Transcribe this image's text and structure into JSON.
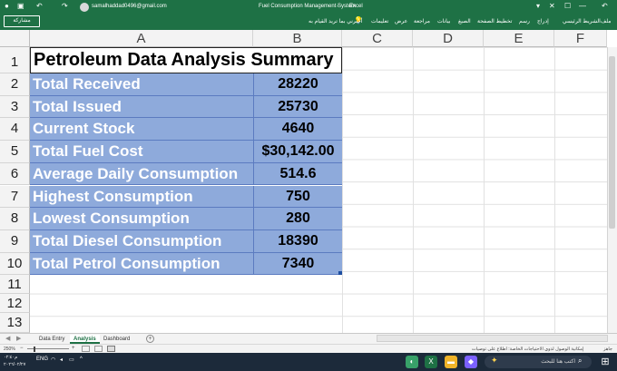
{
  "window": {
    "account_email": "samalhaddad0496@gmail.com",
    "title": "Fuel Consumption Management System",
    "separator": "-",
    "app_name": "Excel"
  },
  "ribbon": {
    "share_label": "مشاركة",
    "tabs": [
      "ملف",
      "الشريط الرئيسي",
      "إدراج",
      "رسم",
      "تخطيط الصفحة",
      "الصيغ",
      "بيانات",
      "مراجعة",
      "عرض",
      "تعليمات"
    ],
    "tell_me": "أخبرني بما تريد القيام به"
  },
  "columns": [
    "A",
    "B",
    "C",
    "D",
    "E",
    "F"
  ],
  "rows": [
    "1",
    "2",
    "3",
    "4",
    "5",
    "6",
    "7",
    "8",
    "9",
    "10",
    "11",
    "12",
    "13"
  ],
  "sheet": {
    "title": "Petroleum Data Analysis Summary",
    "items": [
      {
        "label": "Total Received",
        "value": "28220"
      },
      {
        "label": "Total Issued",
        "value": "25730"
      },
      {
        "label": "Current Stock",
        "value": "4640"
      },
      {
        "label": "Total Fuel Cost",
        "value": "$30,142.00"
      },
      {
        "label": "Average Daily Consumption",
        "value": "514.6"
      },
      {
        "label": "Highest Consumption",
        "value": "750"
      },
      {
        "label": "Lowest Consumption",
        "value": "280"
      },
      {
        "label": "Total Diesel Consumption",
        "value": "18390"
      },
      {
        "label": "Total Petrol Consumption",
        "value": "7340"
      }
    ]
  },
  "sheet_tabs": [
    "Data Entry",
    "Analysis",
    "Dashboard"
  ],
  "active_sheet": "Analysis",
  "status": {
    "ready": "جاهز",
    "accessibility": "إمكانية الوصول لذوي الاحتياجات الخاصة: اطلاع على توصيات",
    "zoom": "250%"
  },
  "taskbar": {
    "search_placeholder": "اكتب هنا للبحث",
    "time": "م٠٢:٤٠",
    "date": "٢٠٢٦/٠٢/٢٧",
    "language": "ENG"
  },
  "colors": {
    "excel_green": "#1e7145",
    "cell_fill": "#8eaadb"
  }
}
